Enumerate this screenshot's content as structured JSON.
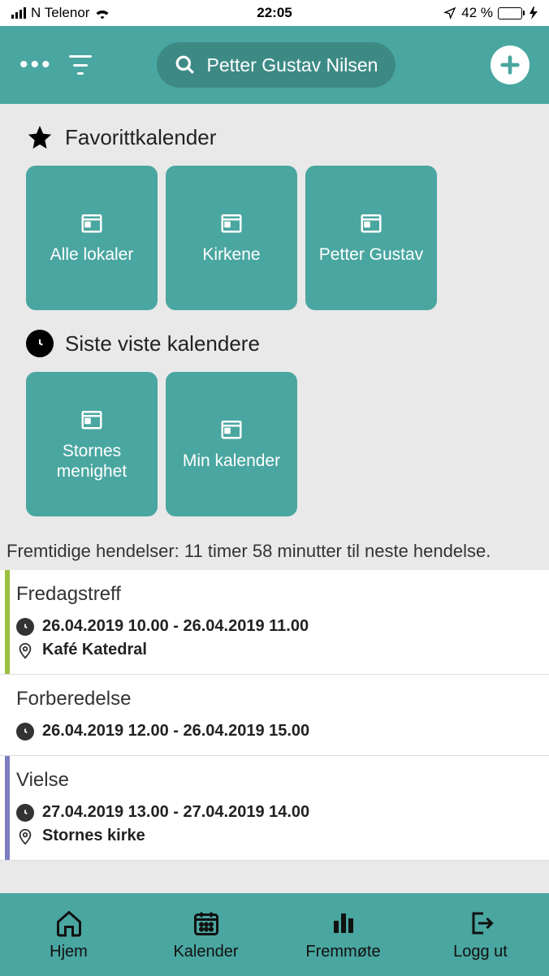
{
  "status": {
    "carrier": "N Telenor",
    "time": "22:05",
    "battery_pct": "42 %"
  },
  "header": {
    "search_text": "Petter Gustav  Nilsen"
  },
  "sections": {
    "favorites_title": "Favorittkalender",
    "recent_title": "Siste viste kalendere"
  },
  "favorite_tiles": [
    {
      "label": "Alle lokaler"
    },
    {
      "label": "Kirkene"
    },
    {
      "label": "Petter Gustav"
    }
  ],
  "recent_tiles": [
    {
      "label": "Stornes menighet"
    },
    {
      "label": "Min kalender"
    }
  ],
  "events_header": "Fremtidige hendelser: 11 timer 58 minutter til neste hendelse.",
  "events": [
    {
      "title": "Fredagstreff",
      "time": "26.04.2019 10.00 - 26.04.2019 11.00",
      "location": "Kafé Katedral",
      "color": "green"
    },
    {
      "title": "Forberedelse",
      "time": "26.04.2019 12.00 - 26.04.2019 15.00",
      "location": "",
      "color": ""
    },
    {
      "title": "Vielse",
      "time": "27.04.2019 13.00 - 27.04.2019 14.00",
      "location": "Stornes kirke",
      "color": "purple"
    }
  ],
  "nav": {
    "home": "Hjem",
    "calendar": "Kalender",
    "attendance": "Fremmøte",
    "logout": "Logg ut"
  }
}
